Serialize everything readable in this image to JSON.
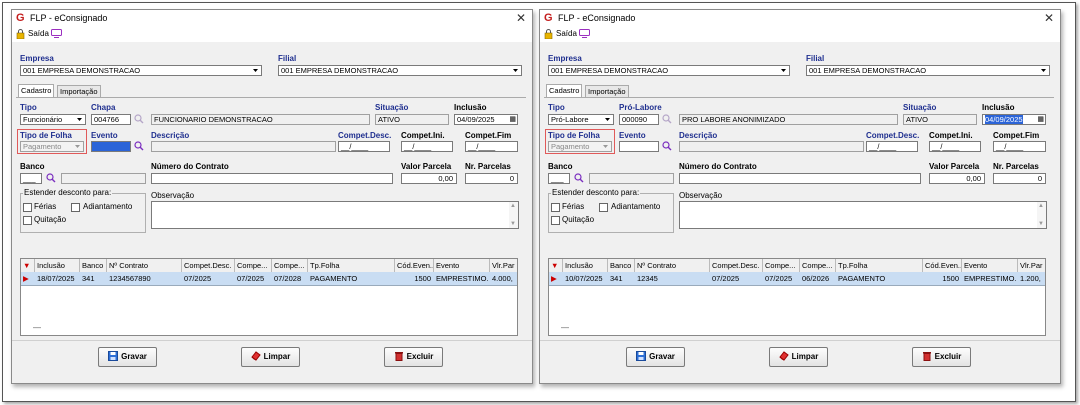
{
  "windows": [
    {
      "title": "FLP - eConsignado",
      "toolbar": {
        "exit_label": "Saída"
      },
      "empresa": {
        "label": "Empresa",
        "value": "001 EMPRESA DEMONSTRACAO"
      },
      "filial": {
        "label": "Filial",
        "value": "001 EMPRESA DEMONSTRACAO"
      },
      "tabs": [
        "Cadastro",
        "Importação"
      ],
      "tipo": {
        "label": "Tipo",
        "value": "Funcionário"
      },
      "chapa": {
        "label": "Chapa",
        "value": "004766",
        "name": "FUNCIONARIO DEMONSTRACAO"
      },
      "situacao": {
        "label": "Situação",
        "value": "ATIVO"
      },
      "inclusao": {
        "label": "Inclusão",
        "value": "04/09/2025"
      },
      "tipo_folha": {
        "label": "Tipo de Folha",
        "value": "Pagamento"
      },
      "evento": {
        "label": "Evento",
        "value": ""
      },
      "descricao": {
        "label": "Descrição",
        "value": ""
      },
      "compet_desc": {
        "label": "Compet.Desc.",
        "value": "__/____"
      },
      "compet_ini": {
        "label": "Compet.Ini.",
        "value": "__/____"
      },
      "compet_fim": {
        "label": "Compet.Fim",
        "value": "__/____"
      },
      "banco": {
        "label": "Banco",
        "value": "___"
      },
      "numero_contrato": {
        "label": "Número do Contrato",
        "value": ""
      },
      "valor_parcela": {
        "label": "Valor Parcela",
        "value": "0,00"
      },
      "nr_parcelas": {
        "label": "Nr. Parcelas",
        "value": "0"
      },
      "estender": {
        "title": "Estender desconto para:",
        "ferias": "Férias",
        "adiantamento": "Adiantamento",
        "quitacao": "Quitação"
      },
      "observacao": {
        "label": "Observação"
      },
      "grid": {
        "columns": [
          "Inclusão",
          "Banco",
          "Nº Contrato",
          "Compet.Desc.",
          "Compe...",
          "Compe...",
          "Tp.Folha",
          "Cód.Even...",
          "Evento",
          "Vlr.Par"
        ],
        "rows": [
          [
            "18/07/2025",
            "341",
            "1234567890",
            "07/2025",
            "07/2025",
            "07/2028",
            "PAGAMENTO",
            "1500",
            "EMPRESTIMO...",
            "4.000,"
          ]
        ],
        "footer": "—"
      },
      "buttons": {
        "save": "Gravar",
        "clear": "Limpar",
        "delete": "Excluir"
      }
    },
    {
      "title": "FLP - eConsignado",
      "toolbar": {
        "exit_label": "Saída"
      },
      "empresa": {
        "label": "Empresa",
        "value": "001 EMPRESA DEMONSTRACAO"
      },
      "filial": {
        "label": "Filial",
        "value": "001 EMPRESA DEMONSTRACAO"
      },
      "tabs": [
        "Cadastro",
        "Importação"
      ],
      "tipo": {
        "label": "Tipo",
        "value": "Pró-Labore"
      },
      "chapa": {
        "label": "Pró-Labore",
        "value": "000090",
        "name": "PRO LABORE ANONIMIZADO"
      },
      "situacao": {
        "label": "Situação",
        "value": "ATIVO"
      },
      "inclusao": {
        "label": "Inclusão",
        "value": "04/09/2025"
      },
      "tipo_folha": {
        "label": "Tipo de Folha",
        "value": "Pagamento"
      },
      "evento": {
        "label": "Evento",
        "value": ""
      },
      "descricao": {
        "label": "Descrição",
        "value": ""
      },
      "compet_desc": {
        "label": "Compet.Desc.",
        "value": "__/____"
      },
      "compet_ini": {
        "label": "Compet.Ini.",
        "value": "__/____"
      },
      "compet_fim": {
        "label": "Compet.Fim",
        "value": "__/____"
      },
      "banco": {
        "label": "Banco",
        "value": "___"
      },
      "numero_contrato": {
        "label": "Número do Contrato",
        "value": ""
      },
      "valor_parcela": {
        "label": "Valor Parcela",
        "value": "0,00"
      },
      "nr_parcelas": {
        "label": "Nr. Parcelas",
        "value": "0"
      },
      "estender": {
        "title": "Estender desconto para:",
        "ferias": "Férias",
        "adiantamento": "Adiantamento",
        "quitacao": "Quitação"
      },
      "observacao": {
        "label": "Observação"
      },
      "grid": {
        "columns": [
          "Inclusão",
          "Banco",
          "Nº Contrato",
          "Compet.Desc.",
          "Compe...",
          "Compe...",
          "Tp.Folha",
          "Cód.Even...",
          "Evento",
          "Vlr.Par"
        ],
        "rows": [
          [
            "10/07/2025",
            "341",
            "12345",
            "07/2025",
            "07/2025",
            "06/2026",
            "PAGAMENTO",
            "1500",
            "EMPRESTIMO...",
            "1.200,"
          ]
        ],
        "footer": "—"
      },
      "buttons": {
        "save": "Gravar",
        "clear": "Limpar",
        "delete": "Excluir"
      }
    }
  ],
  "colors": {
    "label_blue": "#1f2f8f",
    "highlight_red": "#e05a5a",
    "selected_row": "#c9ddf3",
    "logo_red": "#c41e1e"
  }
}
